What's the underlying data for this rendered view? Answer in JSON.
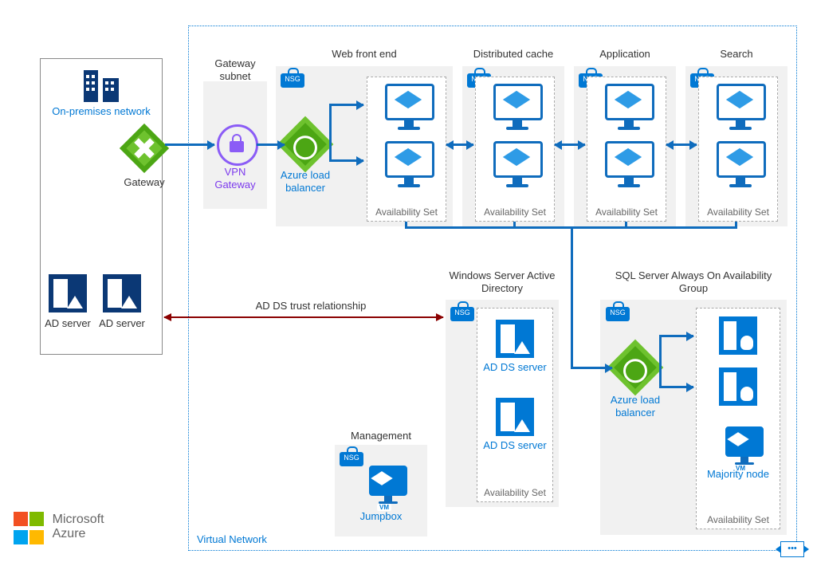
{
  "diagram": {
    "onprem": {
      "title": "On-premises network",
      "gateway": "Gateway",
      "ad1": "AD server",
      "ad2": "AD server"
    },
    "vnet_label": "Virtual Network",
    "gateway_subnet": {
      "title": "Gateway subnet",
      "vpn": "VPN Gateway"
    },
    "web_tier": {
      "title": "Web front end",
      "nsg": "NSG",
      "lb": "Azure load balancer",
      "avail": "Availability Set"
    },
    "cache_tier": {
      "title": "Distributed cache",
      "nsg": "NSG",
      "avail": "Availability Set"
    },
    "app_tier": {
      "title": "Application",
      "nsg": "NSG",
      "avail": "Availability Set"
    },
    "search_tier": {
      "title": "Search",
      "nsg": "NSG",
      "avail": "Availability Set"
    },
    "adds_tier": {
      "title": "Windows Server Active Directory",
      "nsg": "NSG",
      "server1": "AD DS server",
      "server2": "AD DS server",
      "avail": "Availability Set"
    },
    "sql_tier": {
      "title": "SQL Server Always On Availability Group",
      "nsg": "NSG",
      "lb": "Azure load balancer",
      "majority": "Majority node",
      "avail": "Availability Set"
    },
    "mgmt_tier": {
      "title": "Management",
      "nsg": "NSG",
      "jumpbox": "Jumpbox"
    },
    "trust_label": "AD DS trust relationship",
    "logo": {
      "line1": "Microsoft",
      "line2": "Azure"
    }
  }
}
